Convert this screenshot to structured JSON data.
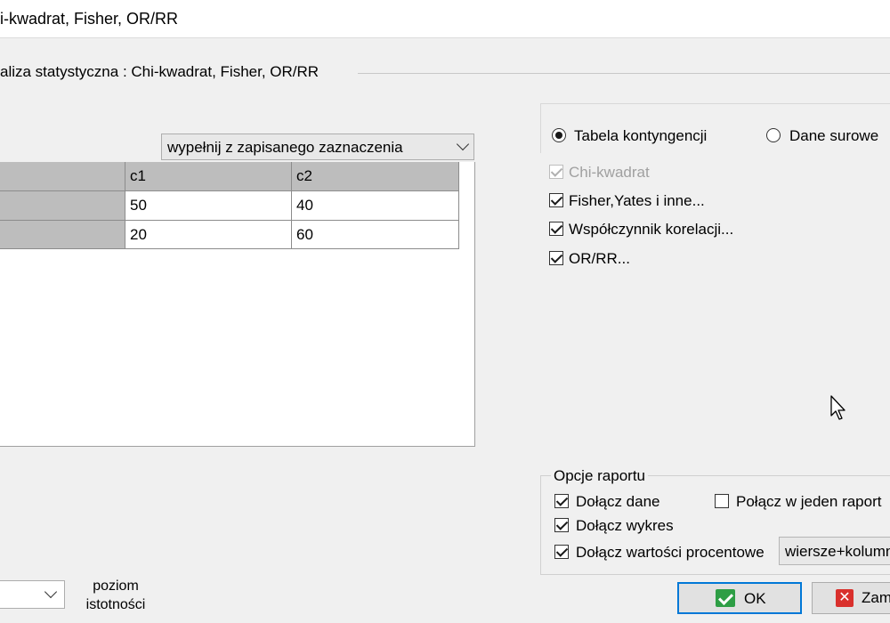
{
  "window": {
    "title": "i-kwadrat, Fisher, OR/RR"
  },
  "group": {
    "title": "aliza statystyczna : Chi-kwadrat, Fisher, OR/RR"
  },
  "fill_combo": {
    "value": "wypełnij z zapisanego zaznaczenia"
  },
  "table": {
    "columns": [
      "c1",
      "c2"
    ],
    "rows": [
      [
        "50",
        "40"
      ],
      [
        "20",
        "60"
      ]
    ]
  },
  "input_mode": {
    "options": [
      "Tabela kontyngencji",
      "Dane surowe"
    ],
    "selected": "Tabela kontyngencji"
  },
  "tests": [
    {
      "label": "Chi-kwadrat",
      "checked": true,
      "enabled": false
    },
    {
      "label": "Fisher,Yates i inne...",
      "checked": true,
      "enabled": true
    },
    {
      "label": "Współczynnik korelacji...",
      "checked": true,
      "enabled": true
    },
    {
      "label": "OR/RR...",
      "checked": true,
      "enabled": true
    }
  ],
  "report": {
    "title": "Opcje raportu",
    "include_data": "Dołącz dane",
    "include_chart": "Dołącz wykres",
    "include_percent": "Dołącz wartości procentowe",
    "merge_report": "Połącz w jeden raport",
    "percent_mode": "wiersze+kolumny"
  },
  "significance": {
    "label": "poziom istotności"
  },
  "buttons": {
    "ok": "OK",
    "close": "Zam"
  },
  "colors": {
    "accent": "#0078d7",
    "ok_icon": "#2e9e45",
    "close_icon": "#d9302c"
  }
}
